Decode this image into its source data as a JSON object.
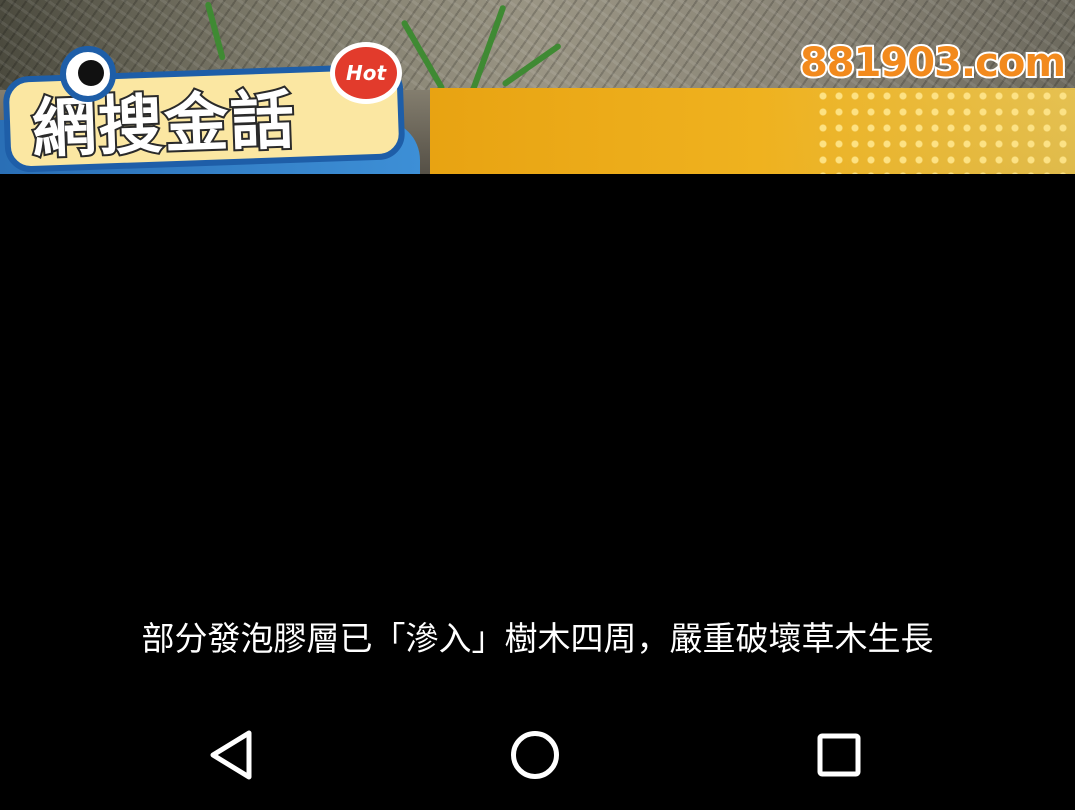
{
  "banner": {
    "logo_text": "網搜金話",
    "hot_badge": "Hot",
    "site_name": "881903.com"
  },
  "caption": "部分發泡膠層已「滲入」樹木四周，嚴重破壞草木生長",
  "navbar": {
    "back_icon": "back-triangle-icon",
    "home_icon": "home-circle-icon",
    "recent_icon": "recent-apps-square-icon"
  },
  "colors": {
    "banner_yellow": "#efb01c",
    "logo_blue": "#1e5ea8",
    "site_orange": "#f28a1d",
    "background": "#000000"
  }
}
